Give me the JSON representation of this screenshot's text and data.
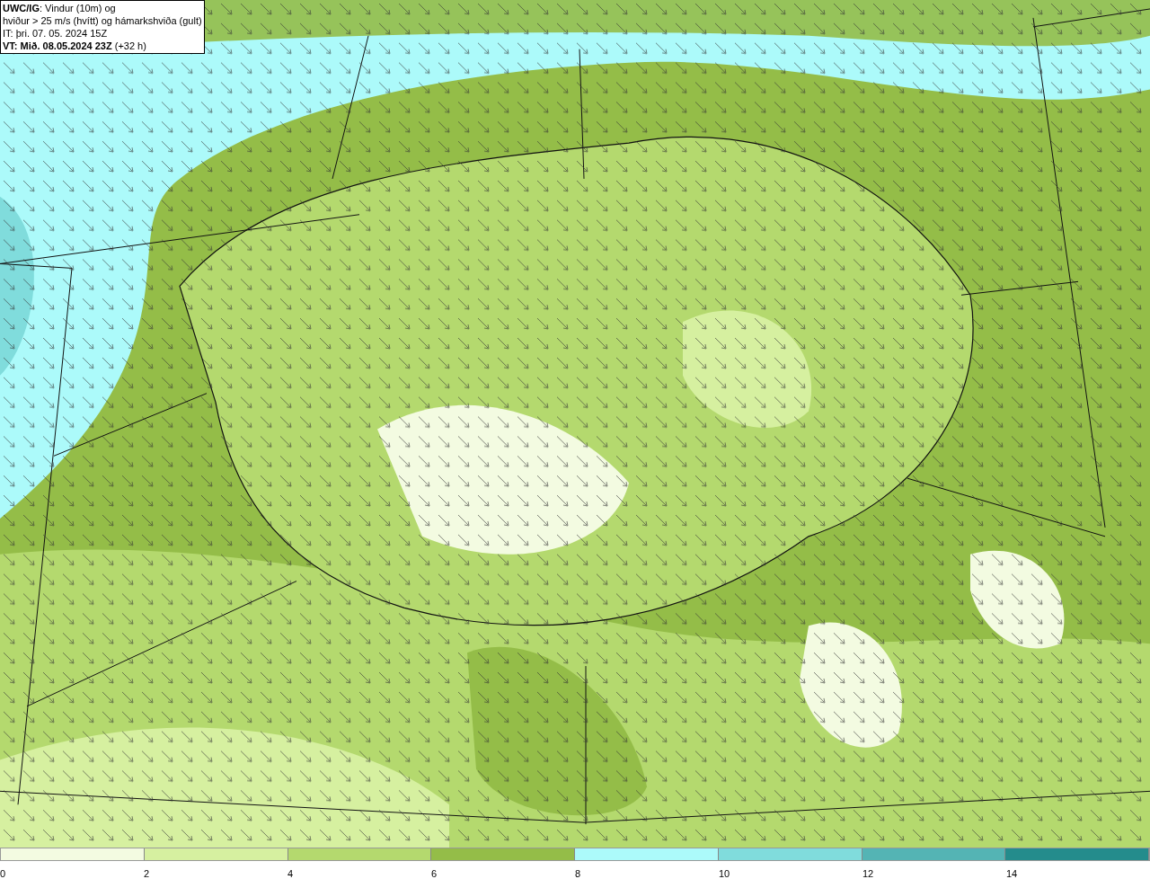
{
  "legend": {
    "lines": [
      "**UWC/IG**: Vindur (10m) og",
      "hviður > 25 m/s (hvítt) og hámarkshviða (gult)",
      "IT: þri. 07. 05. 2024 15Z",
      "**VT: Mið. 08.05.2024 23Z** (+32 h)"
    ]
  },
  "colorbar": [
    {
      "label": "0",
      "color": "#f3fbe1"
    },
    {
      "label": "2",
      "color": "#d6f0a0"
    },
    {
      "label": "4",
      "color": "#b4d96e"
    },
    {
      "label": "6",
      "color": "#94bd48"
    },
    {
      "label": "8",
      "color": "#acfafa"
    },
    {
      "label": "10",
      "color": "#80dcdc"
    },
    {
      "label": "12",
      "color": "#54b4b4"
    },
    {
      "label": "14",
      "color": "#248c8c"
    }
  ]
}
